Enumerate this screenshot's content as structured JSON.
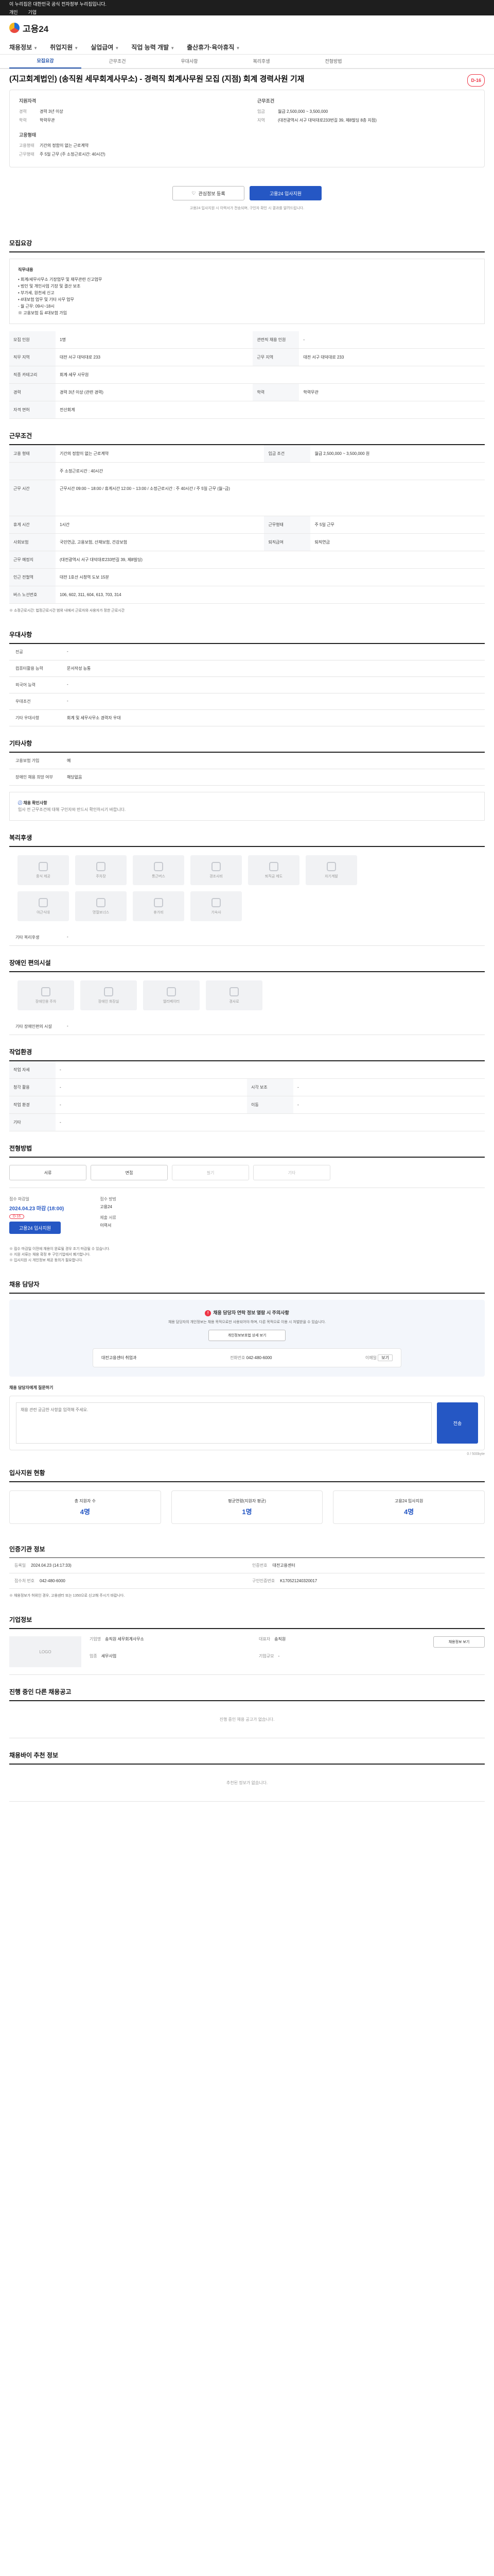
{
  "topbar": {
    "line1": "이 누리집은 대한민국 공식 전자정부 누리집입니다.",
    "link1": "개인",
    "link2": "기업"
  },
  "brand": {
    "name": "고용24"
  },
  "gnb": [
    "채용정보",
    "취업지원",
    "실업급여",
    "직업 능력 개발",
    "출산휴가·육아휴직"
  ],
  "tabs": [
    "모집요강",
    "근무조건",
    "우대사항",
    "복리후생",
    "전형방법"
  ],
  "job": {
    "title": "(지고회계법인) (송직원 세무회계사무소) - 경력직 회계사무원 모집 (지점) 회계 경력사원 기재",
    "dday": "D-16",
    "summary_left_title": "지원자격",
    "summary_left": [
      {
        "k": "경력",
        "v": "경력 3년 이상"
      },
      {
        "k": "학력",
        "v": "학력무관"
      }
    ],
    "summary_left2_title": "고용형태",
    "summary_left2": [
      {
        "k": "고용형태",
        "v": "기간의 정함이 없는 근로계약"
      },
      {
        "k": "근무형태",
        "v": "주 5일 근무 (주 소정근로시간: 40시간)"
      }
    ],
    "summary_right_title": "근무조건",
    "summary_right": [
      {
        "k": "임금",
        "v": "월급 2,500,000 ~ 3,500,000"
      },
      {
        "k": "지역",
        "v": "(대전광역시 서구 대덕대로233번길 39, 제8빌딩 8층 지점)"
      }
    ]
  },
  "actions": {
    "save": "관심정보 등록",
    "apply": "고용24 입사지원",
    "notice": "고용24 입사지원 시 이력서가 전송되며, 구인자 확인 시 결과를 알려드립니다."
  },
  "recruit": {
    "title": "모집요강",
    "duty_label": "직무내용",
    "duty_lines": [
      "• 회계/세무사무소 기장업무 및 재무관련 신고업무",
      "• 법인 및 개인사업 기장 및 결산 보조",
      "• 부가세, 원천세 신고",
      "• 4대보험 업무 및 기타 사무 업무",
      "- 월 근무: 09시~18시",
      "※ 고용보험 등 4대보험 가입"
    ],
    "rows": [
      {
        "k": "모집 인원",
        "v": "1명",
        "k2": "관련직 채용 인원",
        "v2": "-"
      },
      {
        "k": "직무 지역",
        "v": "대전 서구 대덕대로 233",
        "k2": "근무 지역",
        "v2": "대전 서구 대덕대로 233"
      },
      {
        "k": "직종 카테고리",
        "v": "회계·세무 사무원",
        "k2": "",
        "v2": ""
      },
      {
        "k": "경력",
        "v": "경력 3년 이상 (관련 경력)",
        "k2": "학력",
        "v2": "학력무관"
      },
      {
        "k": "자격 면허",
        "v": "전산회계",
        "k2": "",
        "v2": ""
      }
    ]
  },
  "conditions": {
    "title": "근무조건",
    "rows": [
      {
        "k": "고용 형태",
        "v": "기간의 정함이 없는 근로계약",
        "k2": "임금 조건",
        "v2": "월급 2,500,000 ~ 3,500,000 원"
      },
      {
        "k": "",
        "v": "주 소정근로시간 : 40시간",
        "k2": "",
        "v2": ""
      },
      {
        "k": "근무 시간",
        "v": "근무시간 09:00 ~ 18:00 / 휴게시간 12:00 ~ 13:00 / 소정근로시간 : 주 40시간 / 주 5일 근무 (월~금)",
        "k2": "",
        "v2": ""
      },
      {
        "k": "휴게 시간",
        "v": "1시간",
        "k2": "근무형태",
        "v2": "주 5일 근무"
      },
      {
        "k": "사회보험",
        "v": "국민연금, 고용보험, 산재보험, 건강보험",
        "k2": "퇴직급여",
        "v2": "퇴직연금"
      },
      {
        "k": "근무 예정지",
        "v": "(대전광역시 서구 대덕대로233번길 39, 제8빌딩)",
        "k2": "",
        "v2": ""
      },
      {
        "k": "인근 전철역",
        "v": "대전 1호선 시청역 도보 15분",
        "k2": "",
        "v2": ""
      },
      {
        "k": "버스 노선번호",
        "v": "106, 602, 311, 604, 613, 703, 314",
        "k2": "",
        "v2": ""
      }
    ],
    "footnote": "※ 소정근로시간: 법정근로시간 범위 내에서 근로자와 사용자가 정한 근로시간"
  },
  "prefer": {
    "title": "우대사항",
    "rows": [
      {
        "k": "전공",
        "v": "-"
      },
      {
        "k": "컴퓨터활용 능력",
        "v": "문서작성 능통"
      },
      {
        "k": "외국어 능력",
        "v": "-"
      },
      {
        "k": "우대조건",
        "v": "-"
      },
      {
        "k": "기타 우대사항",
        "v": "회계 및 세무사무소 경력자 우대"
      }
    ]
  },
  "etc": {
    "title": "기타사항",
    "rows": [
      {
        "k": "고용보험 가입",
        "v": "예"
      },
      {
        "k": "장애인 채용 희망 여부",
        "v": "해당없음"
      }
    ],
    "warn_title": "채용 확인사항",
    "warn_text": "입사 전 근무조건에 대해 구인자와 반드시 확인하시기 바랍니다."
  },
  "welfare": {
    "title": "복리후생",
    "items": [
      "중식 제공",
      "주차장",
      "통근버스",
      "경조사비",
      "퇴직금 제도",
      "자기계발",
      "야근식대",
      "명절보너스",
      "휴가비",
      "기숙사"
    ],
    "other_label": "기타 복리후생",
    "other_value": "-"
  },
  "disabled": {
    "title": "장애인 편의시설",
    "items": [
      "장애인용 주차",
      "장애인 화장실",
      "엘리베이터",
      "경사로"
    ],
    "other_label": "기타 장애인편의 시설",
    "other_value": "-"
  },
  "worksite": {
    "title": "작업환경",
    "rows": [
      {
        "k": "작업 자세",
        "v": "-",
        "k2": "",
        "v2": ""
      },
      {
        "k": "청각 활용",
        "v": "-",
        "k2": "시각 보조",
        "v2": "-"
      },
      {
        "k": "작업 환경",
        "v": "-",
        "k2": "이동",
        "v2": "-"
      },
      {
        "k": "기타",
        "v": "-",
        "k2": "",
        "v2": ""
      }
    ]
  },
  "method": {
    "title": "전형방법",
    "buttons": [
      "서류",
      "면접",
      "필기",
      "기타"
    ],
    "period_label": "접수 마감일",
    "period_value": "2024.04.23 마감 (18:00)",
    "period_pill": "D-16",
    "apply_btn": "고용24 입사지원",
    "doc_label": "접수 방법",
    "doc_value": "고용24",
    "result_label": "제출 서류",
    "result_value": "이력서",
    "notes": [
      "※ 접수 마감일 이전에 채용이 완료될 경우 조기 마감될 수 있습니다.",
      "※ 지원 서류는 채용 확정 후 구인기업에서 폐기합니다.",
      "※ 입사지원 시 개인정보 제공 동의가 필요합니다."
    ]
  },
  "contact": {
    "title": "채용 담당자",
    "warn": "채용 담당자 연락 정보 열람 시 주의사항",
    "desc": "채용 담당자의 개인정보는 채용 목적으로만 사용되어야 하며, 다른 목적으로 이용 시 처벌받을 수 있습니다.",
    "btn": "개인정보보호법 상세 보기",
    "name_label": "대전고용센터 취업과",
    "phone_label": "전화번호",
    "phone": "042-480-6000",
    "more": "이메일",
    "email_btn": "보기",
    "qna_label": "채용 담당자에게 질문하기",
    "qna_placeholder": "채용 관련 궁금한 사항을 입력해 주세요.",
    "qna_count": "0 / 500byte",
    "qna_send": "전송"
  },
  "stats": {
    "title": "입사지원 현황",
    "items": [
      {
        "label": "총 지원자 수",
        "value": "4명"
      },
      {
        "label": "평균연령(지원자 평균)",
        "value": "1명"
      },
      {
        "label": "고용24 입사지원",
        "value": "4명"
      }
    ]
  },
  "info": {
    "title": "인증기관 정보",
    "rows": [
      {
        "k": "등록일",
        "v": "2024.04.23 (14:17:33)",
        "k2": "인증번호",
        "v2": "대전고용센터"
      },
      {
        "k": "접수처 번호",
        "v": "042-480-6000",
        "k2": "구인인증번호",
        "v2": "K170521240320017"
      }
    ],
    "note": "※ 채용정보가 허위인 경우, 고용센터 또는 1350으로 신고해 주시기 바랍니다."
  },
  "company": {
    "title": "기업정보",
    "logo": "LOGO",
    "rows": [
      {
        "k": "기업명",
        "v": "송직원 세무회계사무소"
      },
      {
        "k": "대표자",
        "v": "송직원"
      },
      {
        "k": "업종",
        "v": "세무사업"
      },
      {
        "k": "기업규모",
        "v": "-"
      }
    ],
    "btn": "채용정보 보기"
  },
  "same_company": {
    "title": "진행 중인 다른 채용공고",
    "empty": "진행 중인 채용 공고가 없습니다."
  },
  "recommend": {
    "title": "채용바이 추천 정보",
    "empty": "추천된 정보가 없습니다."
  }
}
